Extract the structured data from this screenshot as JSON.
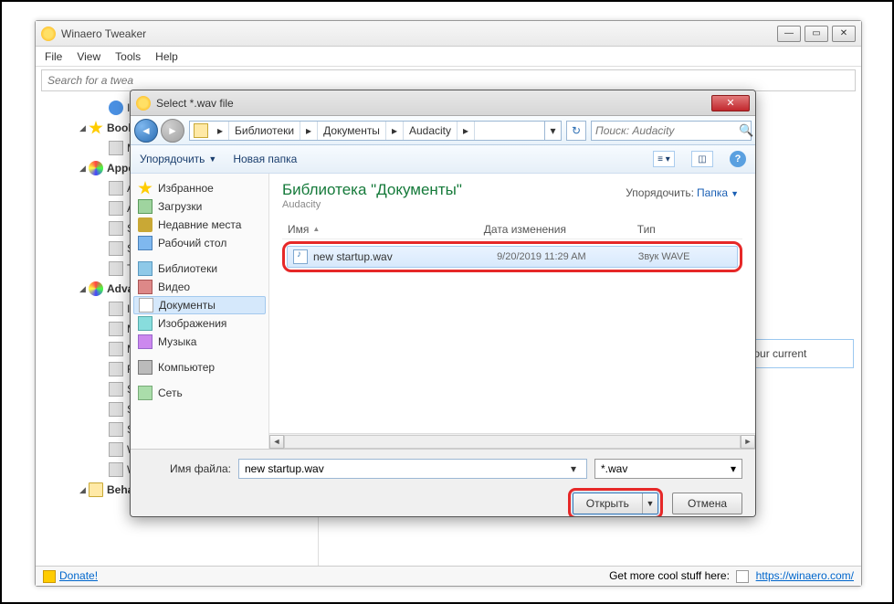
{
  "main_window": {
    "title": "Winaero Tweaker",
    "menu": [
      "File",
      "View",
      "Tools",
      "Help"
    ],
    "search_placeholder": "Search for a twea",
    "content_snippet": "to your current",
    "status_left": "Donate!",
    "status_right_text": "Get more cool stuff here:",
    "status_right_link": "https://winaero.com/",
    "tree": [
      {
        "lvl": 2,
        "icon": "ic-info",
        "label": "Infor"
      },
      {
        "lvl": 1,
        "tw": "◢",
        "icon": "ic-star",
        "label": "Bookma",
        "bold": true
      },
      {
        "lvl": 2,
        "icon": "ic-gen",
        "label": "Man"
      },
      {
        "lvl": 1,
        "tw": "◢",
        "icon": "ic-pal",
        "label": "Appeara",
        "bold": true
      },
      {
        "lvl": 2,
        "icon": "ic-gen",
        "label": "Aero"
      },
      {
        "lvl": 2,
        "icon": "ic-gen",
        "label": "Alt+T"
      },
      {
        "lvl": 2,
        "icon": "ic-gen",
        "label": "Slow"
      },
      {
        "lvl": 2,
        "icon": "ic-gen",
        "label": "Start"
      },
      {
        "lvl": 2,
        "icon": "ic-gen",
        "label": "Ther"
      },
      {
        "lvl": 1,
        "tw": "◢",
        "icon": "ic-pal",
        "label": "Advanc",
        "bold": true
      },
      {
        "lvl": 2,
        "icon": "ic-gen",
        "label": "Icon"
      },
      {
        "lvl": 2,
        "icon": "ic-gen",
        "label": "Men"
      },
      {
        "lvl": 2,
        "icon": "ic-gen",
        "label": "Mess"
      },
      {
        "lvl": 2,
        "icon": "ic-gen",
        "label": "Rese"
      },
      {
        "lvl": 2,
        "icon": "ic-gen",
        "label": "Scro"
      },
      {
        "lvl": 2,
        "icon": "ic-gen",
        "label": "Statu"
      },
      {
        "lvl": 2,
        "icon": "ic-gen",
        "label": "Syste"
      },
      {
        "lvl": 2,
        "icon": "ic-gen",
        "label": "Wind"
      },
      {
        "lvl": 2,
        "icon": "ic-gen",
        "label": "Wind"
      },
      {
        "lvl": 1,
        "tw": "◢",
        "icon": "ic-folder",
        "label": "Behavior",
        "bold": true
      }
    ]
  },
  "dialog": {
    "title": "Select *.wav file",
    "breadcrumbs": [
      "Библиотеки",
      "Документы",
      "Audacity"
    ],
    "search_placeholder": "Поиск: Audacity",
    "toolbar": {
      "organize": "Упорядочить",
      "new_folder": "Новая папка"
    },
    "sidebar": [
      {
        "icon": "sic-star",
        "label": "Избранное",
        "hdr": true
      },
      {
        "icon": "sic-dl",
        "label": "Загрузки"
      },
      {
        "icon": "sic-rec",
        "label": "Недавние места"
      },
      {
        "icon": "sic-desk",
        "label": "Рабочий стол"
      },
      {
        "spacer": true
      },
      {
        "icon": "sic-lib",
        "label": "Библиотеки",
        "hdr": true
      },
      {
        "icon": "sic-vid",
        "label": "Видео"
      },
      {
        "icon": "sic-doc",
        "label": "Документы",
        "sel": true
      },
      {
        "icon": "sic-img",
        "label": "Изображения"
      },
      {
        "icon": "sic-mus",
        "label": "Музыка"
      },
      {
        "spacer": true
      },
      {
        "icon": "sic-comp",
        "label": "Компьютер",
        "hdr": true
      },
      {
        "spacer": true
      },
      {
        "icon": "sic-net",
        "label": "Сеть",
        "hdr": true
      }
    ],
    "library_title": "Библиотека \"Документы\"",
    "library_sub": "Audacity",
    "arrange_label": "Упорядочить:",
    "arrange_value": "Папка",
    "columns": {
      "name": "Имя",
      "date": "Дата изменения",
      "type": "Тип"
    },
    "file": {
      "name": "new startup.wav",
      "date": "9/20/2019 11:29 AM",
      "type": "Звук WAVE"
    },
    "filename_label": "Имя файла:",
    "filename_value": "new startup.wav",
    "filter": "*.wav",
    "open_btn": "Открыть",
    "cancel_btn": "Отмена"
  }
}
